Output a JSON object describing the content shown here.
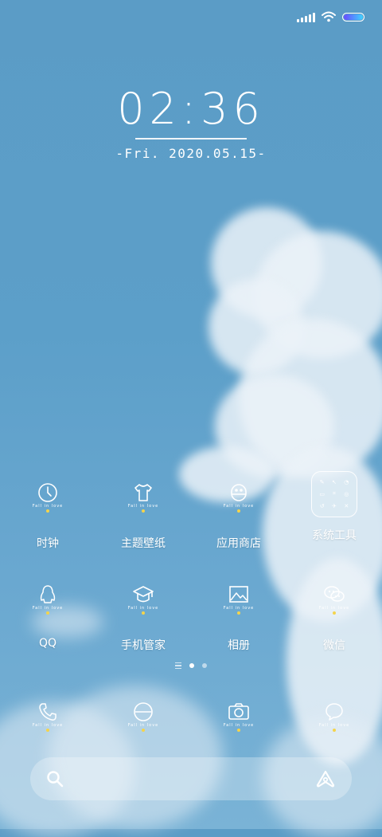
{
  "status_bar": {
    "signal_icon": "signal-icon",
    "wifi_icon": "wifi-icon",
    "battery_icon": "battery-icon",
    "battery_level": 1.0
  },
  "lockscreen_clock": {
    "time": "02:36",
    "date": "-Fri. 2020.05.15-"
  },
  "icon_caption": "Fall in love",
  "apps_row1": [
    {
      "label": "时钟",
      "icon": "clock-icon"
    },
    {
      "label": "主题壁纸",
      "icon": "tshirt-icon"
    },
    {
      "label": "应用商店",
      "icon": "store-robot-icon"
    },
    {
      "label": "系统工具",
      "icon": "folder-icon"
    }
  ],
  "apps_row2": [
    {
      "label": "QQ",
      "icon": "penguin-icon"
    },
    {
      "label": "手机管家",
      "icon": "graduation-cap-icon"
    },
    {
      "label": "相册",
      "icon": "gallery-icon"
    },
    {
      "label": "微信",
      "icon": "wechat-icon"
    }
  ],
  "dock": [
    {
      "icon": "phone-icon"
    },
    {
      "icon": "browser-icon"
    },
    {
      "icon": "camera-icon"
    },
    {
      "icon": "message-icon"
    }
  ],
  "pager": {
    "pages": 2,
    "current": 1
  },
  "search_bar": {
    "search_icon": "search-icon",
    "assistant_icon": "assistant-icon"
  },
  "colors": {
    "sky": "#5c9fc9",
    "battery_gradient_start": "#6a4bff",
    "battery_gradient_end": "#3fd3ff",
    "icon_dot": "#f4d44c"
  }
}
